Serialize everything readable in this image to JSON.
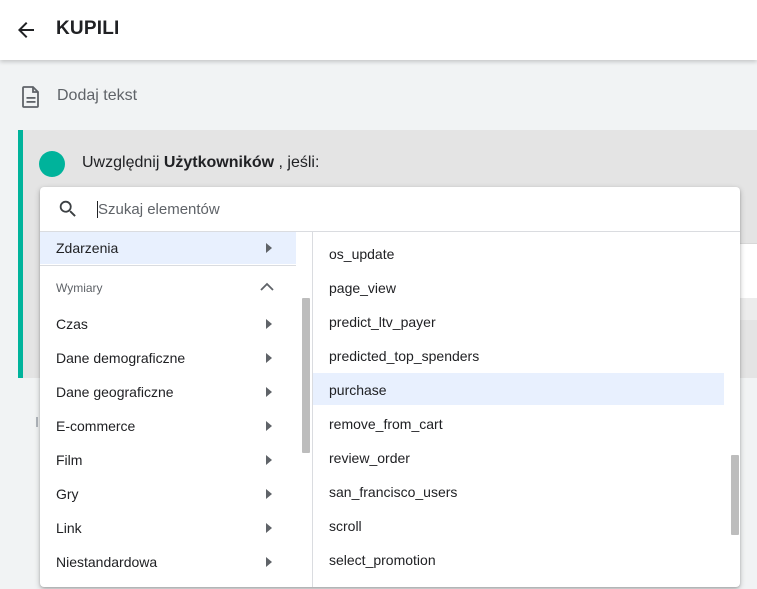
{
  "header": {
    "title": "KUPILI",
    "back_icon": "arrow-back-icon"
  },
  "description": {
    "placeholder_text": "Dodaj tekst",
    "icon": "document-icon"
  },
  "condition": {
    "prefix": "Uwzględnij",
    "subject": "Użytkowników",
    "suffix": ", jeśli:",
    "accent_color": "#00b39b"
  },
  "picker": {
    "search_placeholder": "Szukaj elementów",
    "left_items": [
      {
        "label": "Zdarzenia",
        "active": true
      }
    ],
    "section_label": "Wymiary",
    "dimension_items": [
      {
        "label": "Czas"
      },
      {
        "label": "Dane demograficzne"
      },
      {
        "label": "Dane geograficzne"
      },
      {
        "label": "E-commerce"
      },
      {
        "label": "Film"
      },
      {
        "label": "Gry"
      },
      {
        "label": "Link"
      },
      {
        "label": "Niestandardowa"
      }
    ],
    "right_items": [
      {
        "label": "os_update"
      },
      {
        "label": "page_view"
      },
      {
        "label": "predict_ltv_payer"
      },
      {
        "label": "predicted_top_spenders"
      },
      {
        "label": "purchase",
        "active": true
      },
      {
        "label": "remove_from_cart"
      },
      {
        "label": "review_order"
      },
      {
        "label": "san_francisco_users"
      },
      {
        "label": "scroll"
      },
      {
        "label": "select_promotion"
      }
    ],
    "highlight_color": "#e8f0fe"
  }
}
